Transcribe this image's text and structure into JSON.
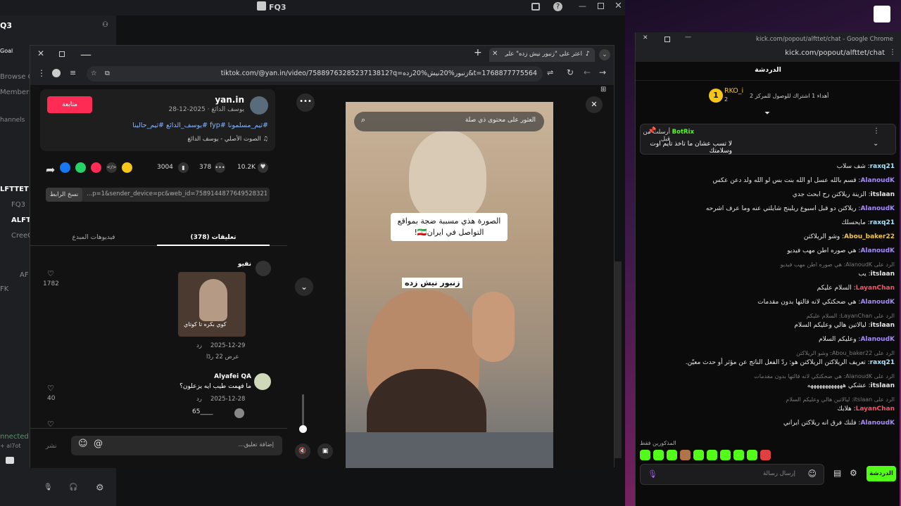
{
  "bg_app": {
    "title": "FQ3",
    "server": "Q3",
    "side": [
      "Goal",
      "Browse Ch",
      "Members",
      "hannels"
    ],
    "names": [
      "LFTTET",
      "FQ3",
      "ALFTT",
      "CreeC",
      "AF",
      "FK"
    ],
    "connected": "nnected",
    "connected_sub": "+ al7ot"
  },
  "tiktok": {
    "tab_title": "اعثر على \"زنبور نيش زده\" على",
    "url": "tiktok.com/@yan.in/video/7588976328523713812?q=زنبور%20نيش%20زده&t=1768877775564",
    "author": "yan.in",
    "author_sub": "يوسف الدائغ · 2025-12-28",
    "follow": "متابعة",
    "hashtags": "#ثيم_مسلمونا #fyp #يوسف_الدائع #ثيم_حالينا",
    "sound": "الصوت الأصلي - يوسف الدائغ",
    "likes": "10.2K",
    "comments": "378",
    "saves": "3004",
    "link": "...p=1&sender_device=pc&web_id=7589144877649528321",
    "copy_link": "نسخ الرابط",
    "tab_comments": "تعليقات (378)",
    "tab_videos": "فيديوهات المبدع",
    "comments_list": [
      {
        "user": "نقيو",
        "sticker": "كوي بكره تا كوتاي",
        "date": "2025-12-29",
        "reply": "رد",
        "likes": "1782",
        "view_replies": "عرض 22 ردًا"
      },
      {
        "user": "Alyafei QA",
        "text": "ما فهمت طيب ايه يزعلون؟",
        "date": "2025-12-28",
        "reply": "رد",
        "likes": "40"
      },
      {
        "user": "65____"
      }
    ],
    "comment_placeholder": "إضافة تعليق...",
    "post": "نشر",
    "search_placeholder": "العثور على محتوى ذي صلة",
    "caption": "الصورة هذي مسببة ضجة بمواقع التواصل في ايران🇮🇷!",
    "video_text": "زنبور نيش زده"
  },
  "chat": {
    "win_title": "kick.com/popout/alfttet/chat - Google Chrome",
    "url": "kick.com/popout/alfttet/chat",
    "header": "الدردشة",
    "top_gifter": "RKO_i",
    "top_gifter_count": "2",
    "gift_text": "أهداء 1 اشتراك للوصول للمركز 2",
    "pinned_by": "BotRix",
    "pinned_sent": "أرسلت من قبل",
    "pinned_text": "لا تسب عشان ما تاخذ تايم اوت وسلامتك",
    "messages": [
      {
        "type": "msg",
        "user": "raxq21",
        "color": "#a8e6ff",
        "text": "شف سلاب"
      },
      {
        "type": "msg",
        "user": "AlanoudK",
        "color": "#a78bfa",
        "text": "قسم بالله عسل او الله بنت بس لو الله ولد دعن عكس"
      },
      {
        "type": "msg",
        "user": "itslaan",
        "color": "#e8e8e8",
        "text": "الزينة ريلاكتن رح ابحث جدي"
      },
      {
        "type": "msg",
        "user": "AlanoudK",
        "color": "#a78bfa",
        "text": "ريلاكتن دو قبل اسبوع ريلينج شايلتي عنه وما عرف اشرحه"
      },
      {
        "type": "msg",
        "user": "raxq21",
        "color": "#a8e6ff",
        "text": "مايحسلك"
      },
      {
        "type": "msg",
        "user": "Abou_baker22",
        "color": "#f5c542",
        "text": "وشو الريلاكتن"
      },
      {
        "type": "msg",
        "user": "AlanoudK",
        "color": "#a78bfa",
        "text": "هي صوره اطن مهب فيديو"
      },
      {
        "type": "reply",
        "text": "الرد على AlanoudK: هي صوره اطن مهب فيديو"
      },
      {
        "type": "msg",
        "user": "itslaan",
        "color": "#e8e8e8",
        "text": "يب"
      },
      {
        "type": "msg",
        "user": "LayanChan",
        "color": "#ff4d6d",
        "text": "السلام عليكم"
      },
      {
        "type": "msg",
        "user": "AlanoudK",
        "color": "#a78bfa",
        "text": "هي ضحكتكي لانه قالتها بدون مقدمات"
      },
      {
        "type": "reply",
        "text": "الرد على LayanChan: السلام عليكم"
      },
      {
        "type": "msg",
        "user": "itslaan",
        "color": "#e8e8e8",
        "text": "ليالاتين هالي وعليكم السلام"
      },
      {
        "type": "msg",
        "user": "AlanoudK",
        "color": "#a78bfa",
        "text": "وعليكم السلام"
      },
      {
        "type": "reply",
        "text": "الرد على Abou_baker22: وشو الريلاكتن"
      },
      {
        "type": "msg",
        "user": "raxq21",
        "color": "#a8e6ff",
        "text": "تعريف الريلاكتن الريلاكتن هو: ردّ الفعل الناتج عن مؤثر أو حدث معيّن."
      },
      {
        "type": "reply",
        "text": "الرد على AlanoudK: هي ضحكتكي لانه قالتها بدون مقدمات"
      },
      {
        "type": "msg",
        "user": "itslaan",
        "color": "#e8e8e8",
        "text": "عشكي ههههههههههههه"
      },
      {
        "type": "reply",
        "text": "الرد على itslaan: ليالاتين هالي وعليكم السلام"
      },
      {
        "type": "msg",
        "user": "LayanChan",
        "color": "#ff4d6d",
        "text": "هلابك"
      },
      {
        "type": "msg",
        "user": "AlanoudK",
        "color": "#a78bfa",
        "text": "فلنك فرق انه ريلاكتن ايراني"
      }
    ],
    "emote_label": "المذكورين فقط",
    "input_placeholder": "إرسال رسالة",
    "send": "الدردشة"
  },
  "colors": {
    "follow": "#fe2c55",
    "kick_green": "#53fc18"
  }
}
